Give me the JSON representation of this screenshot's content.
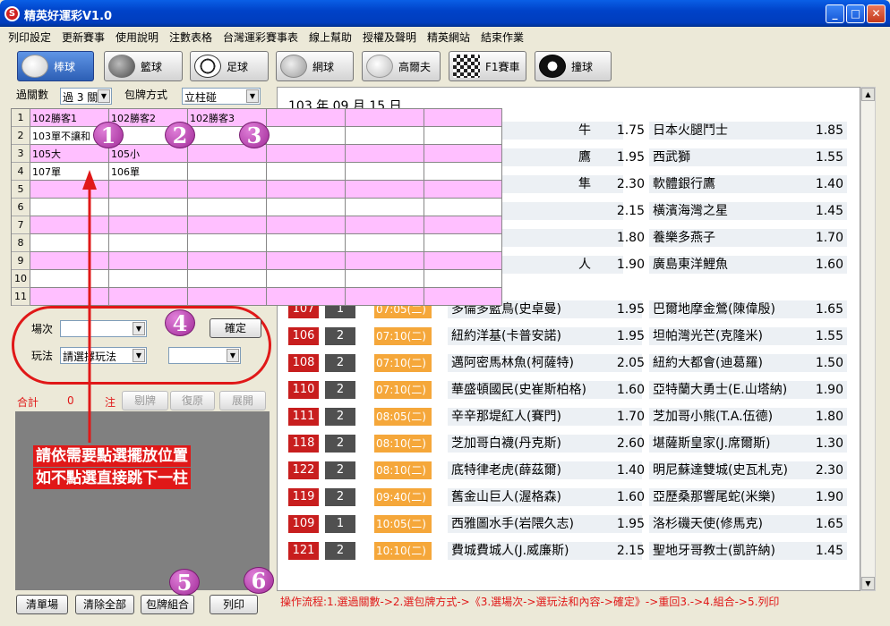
{
  "window": {
    "title": "精英好運彩V1.0"
  },
  "menu": [
    "列印設定",
    "更新賽事",
    "使用說明",
    "注數表格",
    "台灣運彩賽事表",
    "線上幫助",
    "授權及聲明",
    "精英網站",
    "結束作業"
  ],
  "sports": [
    {
      "label": "棒球",
      "icon": "baseball-icon"
    },
    {
      "label": "籃球",
      "icon": "basketball-icon"
    },
    {
      "label": "足球",
      "icon": "soccer-ball-icon"
    },
    {
      "label": "網球",
      "icon": "tennis-ball-icon"
    },
    {
      "label": "高爾夫",
      "icon": "golf-ball-icon"
    },
    {
      "label": "F1賽車",
      "icon": "checkered-flag-icon"
    },
    {
      "label": "撞球",
      "icon": "eight-ball-icon"
    }
  ],
  "controls": {
    "guoguan_label": "過關數",
    "guoguan_value": "過 3 關",
    "baopai_label": "包牌方式",
    "baopai_value": "立柱碰"
  },
  "grid": {
    "rows": [
      [
        "102勝客1",
        "102勝客2",
        "102勝客3",
        "",
        "",
        ""
      ],
      [
        "103單不讓和",
        "",
        "",
        "",
        "",
        ""
      ],
      [
        "105大",
        "105小",
        "",
        "",
        "",
        ""
      ],
      [
        "107單",
        "106單",
        "",
        "",
        "",
        ""
      ],
      [
        "",
        "",
        "",
        "",
        "",
        ""
      ],
      [
        "",
        "",
        "",
        "",
        "",
        ""
      ],
      [
        "",
        "",
        "",
        "",
        "",
        ""
      ],
      [
        "",
        "",
        "",
        "",
        "",
        ""
      ],
      [
        "",
        "",
        "",
        "",
        "",
        ""
      ],
      [
        "",
        "",
        "",
        "",
        "",
        ""
      ],
      [
        "",
        "",
        "",
        "",
        "",
        ""
      ]
    ],
    "row_numbers": [
      "1",
      "2",
      "3",
      "4",
      "5",
      "6",
      "7",
      "8",
      "9",
      "10",
      "11"
    ]
  },
  "callouts": [
    "1",
    "2",
    "3",
    "4",
    "5",
    "6"
  ],
  "form": {
    "changci_label": "場次",
    "wanfa_label": "玩法",
    "wanfa_value": "請選擇玩法",
    "confirm": "確定"
  },
  "summary": {
    "total_label": "合計",
    "total_value": "0",
    "unit": "注",
    "btn_remove": "剔牌",
    "btn_restore": "復原",
    "btn_expand": "展開"
  },
  "note": [
    "請依需要點選擺放位置",
    "如不點選直接跳下一柱"
  ],
  "bottom_buttons": {
    "clear_field": "清單場",
    "clear_all": "清除全部",
    "combine": "包牌組合",
    "print": "列印"
  },
  "flow_text": "操作流程:1.選過關數->2.選包牌方式->《3.選場次->選玩法和內容->確定》->重回3.->4.組合->5.列印",
  "right_header": "103 年 09 月 15 日",
  "upper_matches": [
    {
      "teamA": "牛",
      "oddA": "1.75",
      "teamB": "日本火腿鬥士",
      "oddB": "1.85"
    },
    {
      "teamA": "鷹",
      "oddA": "1.95",
      "teamB": "西武獅",
      "oddB": "1.55"
    },
    {
      "teamA": "隼",
      "oddA": "2.30",
      "teamB": "軟體銀行鷹",
      "oddB": "1.40"
    },
    {
      "teamA": "",
      "oddA": "2.15",
      "teamB": "橫濱海灣之星",
      "oddB": "1.45"
    },
    {
      "teamA": "",
      "oddA": "1.80",
      "teamB": "養樂多燕子",
      "oddB": "1.70"
    },
    {
      "teamA": "人",
      "oddA": "1.90",
      "teamB": "廣島東洋鯉魚",
      "oddB": "1.60"
    }
  ],
  "matches": [
    {
      "no": "107",
      "q": "1",
      "time": "07:05(二)",
      "teamA": "多倫多藍鳥(史卓曼)",
      "oddA": "1.95",
      "teamB": "巴爾地摩金鶯(陳偉殷)",
      "oddB": "1.65"
    },
    {
      "no": "106",
      "q": "2",
      "time": "07:10(二)",
      "teamA": "紐約洋基(卡普安諾)",
      "oddA": "1.95",
      "teamB": "坦帕灣光芒(克隆米)",
      "oddB": "1.55"
    },
    {
      "no": "108",
      "q": "2",
      "time": "07:10(二)",
      "teamA": "邁阿密馬林魚(柯薩特)",
      "oddA": "2.05",
      "teamB": "紐約大都會(迪葛羅)",
      "oddB": "1.50"
    },
    {
      "no": "110",
      "q": "2",
      "time": "07:10(二)",
      "teamA": "華盛頓國民(史崔斯柏格)",
      "oddA": "1.60",
      "teamB": "亞特蘭大勇士(E.山塔納)",
      "oddB": "1.90"
    },
    {
      "no": "111",
      "q": "2",
      "time": "08:05(二)",
      "teamA": "辛辛那堤紅人(賽門)",
      "oddA": "1.70",
      "teamB": "芝加哥小熊(T.A.伍德)",
      "oddB": "1.80"
    },
    {
      "no": "118",
      "q": "2",
      "time": "08:10(二)",
      "teamA": "芝加哥白襪(丹克斯)",
      "oddA": "2.60",
      "teamB": "堪薩斯皇家(J.席爾斯)",
      "oddB": "1.30"
    },
    {
      "no": "122",
      "q": "2",
      "time": "08:10(二)",
      "teamA": "底特律老虎(薛茲爾)",
      "oddA": "1.40",
      "teamB": "明尼蘇達雙城(史瓦札克)",
      "oddB": "2.30"
    },
    {
      "no": "119",
      "q": "2",
      "time": "09:40(二)",
      "teamA": "舊金山巨人(渥格森)",
      "oddA": "1.60",
      "teamB": "亞歷桑那響尾蛇(米樂)",
      "oddB": "1.90"
    },
    {
      "no": "109",
      "q": "1",
      "time": "10:05(二)",
      "teamA": "西雅圖水手(岩隈久志)",
      "oddA": "1.95",
      "teamB": "洛杉磯天使(修馬克)",
      "oddB": "1.65"
    },
    {
      "no": "121",
      "q": "2",
      "time": "10:10(二)",
      "teamA": "費城費城人(J.威廉斯)",
      "oddA": "2.15",
      "teamB": "聖地牙哥教士(凱許納)",
      "oddB": "1.45"
    }
  ],
  "colors": {
    "accent_red": "#e01818",
    "pink": "#ffbfff",
    "time_orange": "#f5a73a",
    "number_red": "#c81e1e"
  }
}
